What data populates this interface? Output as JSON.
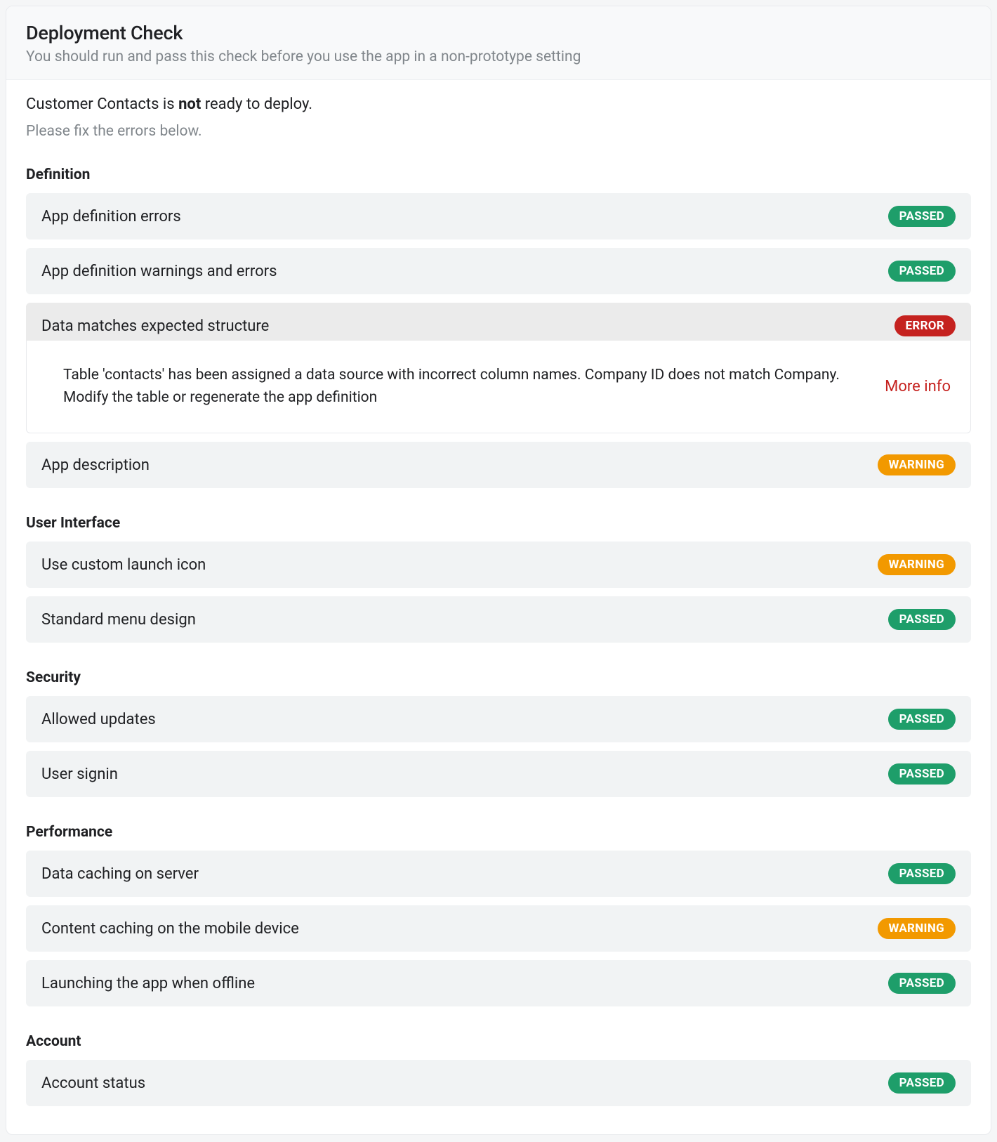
{
  "header": {
    "title": "Deployment Check",
    "subtitle": "You should run and pass this check before you use the app in a non-prototype setting"
  },
  "status": {
    "prefix": "Customer Contacts is ",
    "emphasis": "not",
    "suffix": " ready to deploy.",
    "sub": "Please fix the errors below."
  },
  "badges": {
    "passed": "PASSED",
    "warning": "WARNING",
    "error": "ERROR"
  },
  "moreInfo": "More info",
  "sections": {
    "definition": {
      "title": "Definition",
      "items": {
        "app_definition_errors": {
          "label": "App definition errors",
          "status": "passed"
        },
        "app_definition_warnings": {
          "label": "App definition warnings and errors",
          "status": "passed"
        },
        "data_matches": {
          "label": "Data matches expected structure",
          "status": "error",
          "detail": "Table 'contacts' has been assigned a data source with incorrect column names. Company ID does not match Company. Modify the table or regenerate the app definition"
        },
        "app_description": {
          "label": "App description",
          "status": "warning"
        }
      }
    },
    "ui": {
      "title": "User Interface",
      "items": {
        "custom_launch_icon": {
          "label": "Use custom launch icon",
          "status": "warning"
        },
        "standard_menu": {
          "label": "Standard menu design",
          "status": "passed"
        }
      }
    },
    "security": {
      "title": "Security",
      "items": {
        "allowed_updates": {
          "label": "Allowed updates",
          "status": "passed"
        },
        "user_signin": {
          "label": "User signin",
          "status": "passed"
        }
      }
    },
    "performance": {
      "title": "Performance",
      "items": {
        "data_caching": {
          "label": "Data caching on server",
          "status": "passed"
        },
        "content_caching": {
          "label": "Content caching on the mobile device",
          "status": "warning"
        },
        "launch_offline": {
          "label": "Launching the app when offline",
          "status": "passed"
        }
      }
    },
    "account": {
      "title": "Account",
      "items": {
        "account_status": {
          "label": "Account status",
          "status": "passed"
        }
      }
    }
  }
}
